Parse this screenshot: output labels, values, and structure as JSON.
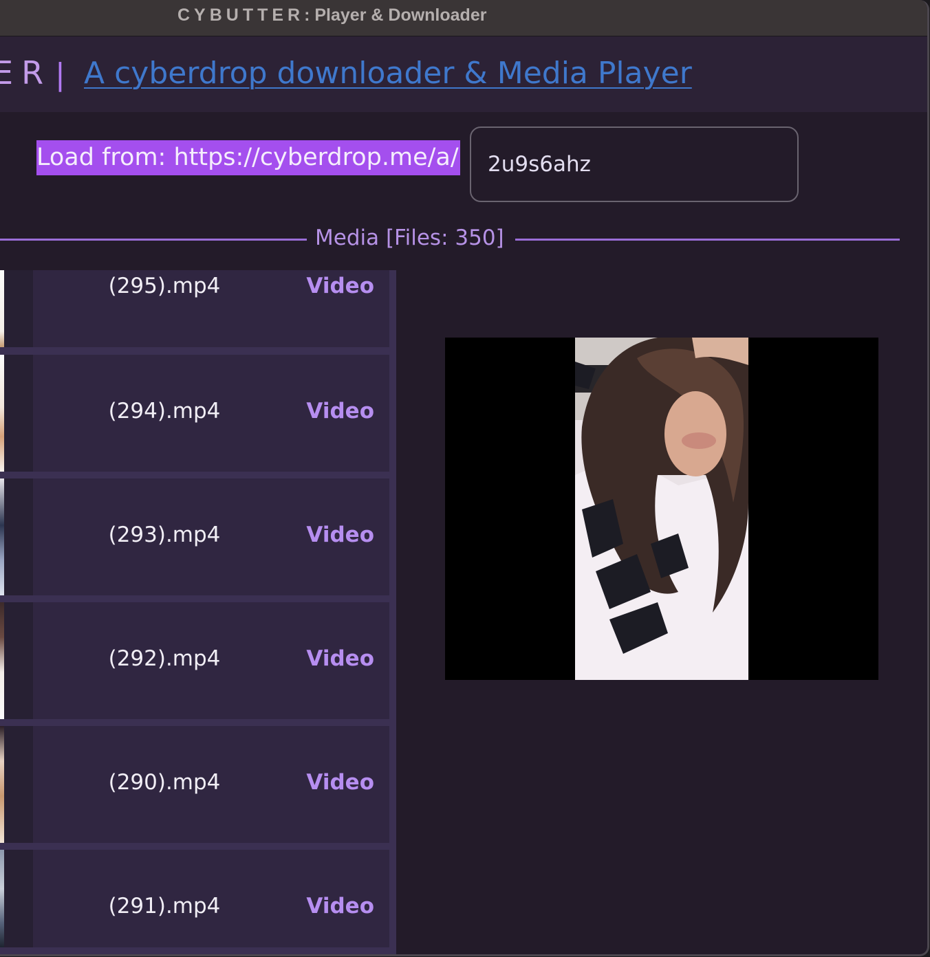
{
  "window": {
    "title_app": "CYBUTTER",
    "title_rest": ": Player & Downloader"
  },
  "header": {
    "brand_visible": "ER",
    "separator": "|",
    "tagline": "A cyberdrop downloader & Media Player"
  },
  "loader": {
    "label": "Load from: https://cyberdrop.me/a/",
    "album_id": "2u9s6ahz"
  },
  "media": {
    "section_label": "Media [Files: 350]",
    "items": [
      {
        "name": "(295).mp4",
        "type": "Video"
      },
      {
        "name": "(294).mp4",
        "type": "Video"
      },
      {
        "name": "(293).mp4",
        "type": "Video"
      },
      {
        "name": "(292).mp4",
        "type": "Video"
      },
      {
        "name": "(290).mp4",
        "type": "Video"
      },
      {
        "name": "(291).mp4",
        "type": "Video"
      }
    ]
  },
  "colors": {
    "accent": "#a44fee",
    "link": "#3f78cc",
    "type_label": "#b68ef0",
    "background": "#231b29"
  }
}
